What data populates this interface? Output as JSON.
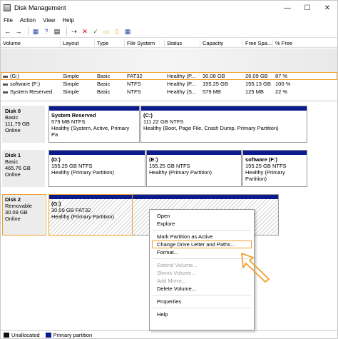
{
  "window": {
    "title": "Disk Management"
  },
  "title_buttons": {
    "minimize": "—",
    "maximize": "☐",
    "close": "✕"
  },
  "menu": [
    "File",
    "Action",
    "View",
    "Help"
  ],
  "toolbar": [
    {
      "icon": "back-arrow-icon",
      "glyph": "←"
    },
    {
      "icon": "forward-arrow-icon",
      "glyph": "→"
    },
    {
      "icon": "list-view-icon",
      "glyph": "▦"
    },
    {
      "icon": "help-icon",
      "glyph": "?"
    },
    {
      "icon": "properties-icon",
      "glyph": "▤"
    },
    {
      "icon": "connect-icon",
      "glyph": "⇢"
    },
    {
      "icon": "delete-icon",
      "glyph": "✕"
    },
    {
      "icon": "check-icon",
      "glyph": "✓"
    },
    {
      "icon": "folder-icon",
      "glyph": "▭"
    },
    {
      "icon": "page-icon",
      "glyph": "▯"
    },
    {
      "icon": "grid-icon",
      "glyph": "▦"
    }
  ],
  "colors": {
    "partition_bar": "#0b1a8c",
    "highlight": "#f0a030",
    "unallocated": "#111111"
  },
  "volume_columns": [
    "Volume",
    "Layout",
    "Type",
    "File System",
    "Status",
    "Capacity",
    "Free Spa...",
    "% Free"
  ],
  "volumes": [
    {
      "volume": "(G:)",
      "layout": "Simple",
      "type": "Basic",
      "fs": "FAT32",
      "status": "Healthy (P...",
      "capacity": "30.08 GB",
      "free": "26.09 GB",
      "pct": "87 %"
    },
    {
      "volume": "software (F:)",
      "layout": "Simple",
      "type": "Basic",
      "fs": "NTFS",
      "status": "Healthy (P...",
      "capacity": "155.25 GB",
      "free": "155.13 GB",
      "pct": "100 %"
    },
    {
      "volume": "System Reserved",
      "layout": "Simple",
      "type": "Basic",
      "fs": "NTFS",
      "status": "Healthy (S...",
      "capacity": "579 MB",
      "free": "125 MB",
      "pct": "22 %"
    }
  ],
  "disks": [
    {
      "name": "Disk 0",
      "type": "Basic",
      "size": "111.79 GB",
      "status": "Online",
      "partitions": [
        {
          "name": "System Reserved",
          "size": "579 MB NTFS",
          "status": "Healthy (System, Active, Primary Pa"
        },
        {
          "name": "(C:)",
          "size": "111.22 GB NTFS",
          "status": "Healthy (Boot, Page File, Crash Dump, Primary Partition)"
        }
      ]
    },
    {
      "name": "Disk 1",
      "type": "Basic",
      "size": "465.76 GB",
      "status": "Online",
      "partitions": [
        {
          "name": "(D:)",
          "size": "155.25 GB NTFS",
          "status": "Healthy (Primary Partition)"
        },
        {
          "name": "(E:)",
          "size": "155.25 GB NTFS",
          "status": "Healthy (Primary Partition)"
        },
        {
          "name": "software (F:)",
          "size": "155.25 GB NTFS",
          "status": "Healthy (Primary Partition)"
        }
      ]
    },
    {
      "name": "Disk 2",
      "type": "Removable",
      "size": "30.09 GB",
      "status": "Online",
      "partitions": [
        {
          "name": "(G:)",
          "size": "30.09 GB FAT32",
          "status": "Healthy (Primary Partition)"
        }
      ]
    }
  ],
  "context_menu": {
    "open": "Open",
    "explore": "Explore",
    "mark_active": "Mark Partition as Active",
    "change_letter": "Change Drive Letter and Paths...",
    "format": "Format...",
    "extend": "Extend Volume...",
    "shrink": "Shrink Volume...",
    "mirror": "Add Mirror...",
    "delete": "Delete Volume...",
    "properties": "Properties",
    "help": "Help"
  },
  "legend": {
    "unallocated": "Unallocated",
    "primary": "Primary partition"
  }
}
